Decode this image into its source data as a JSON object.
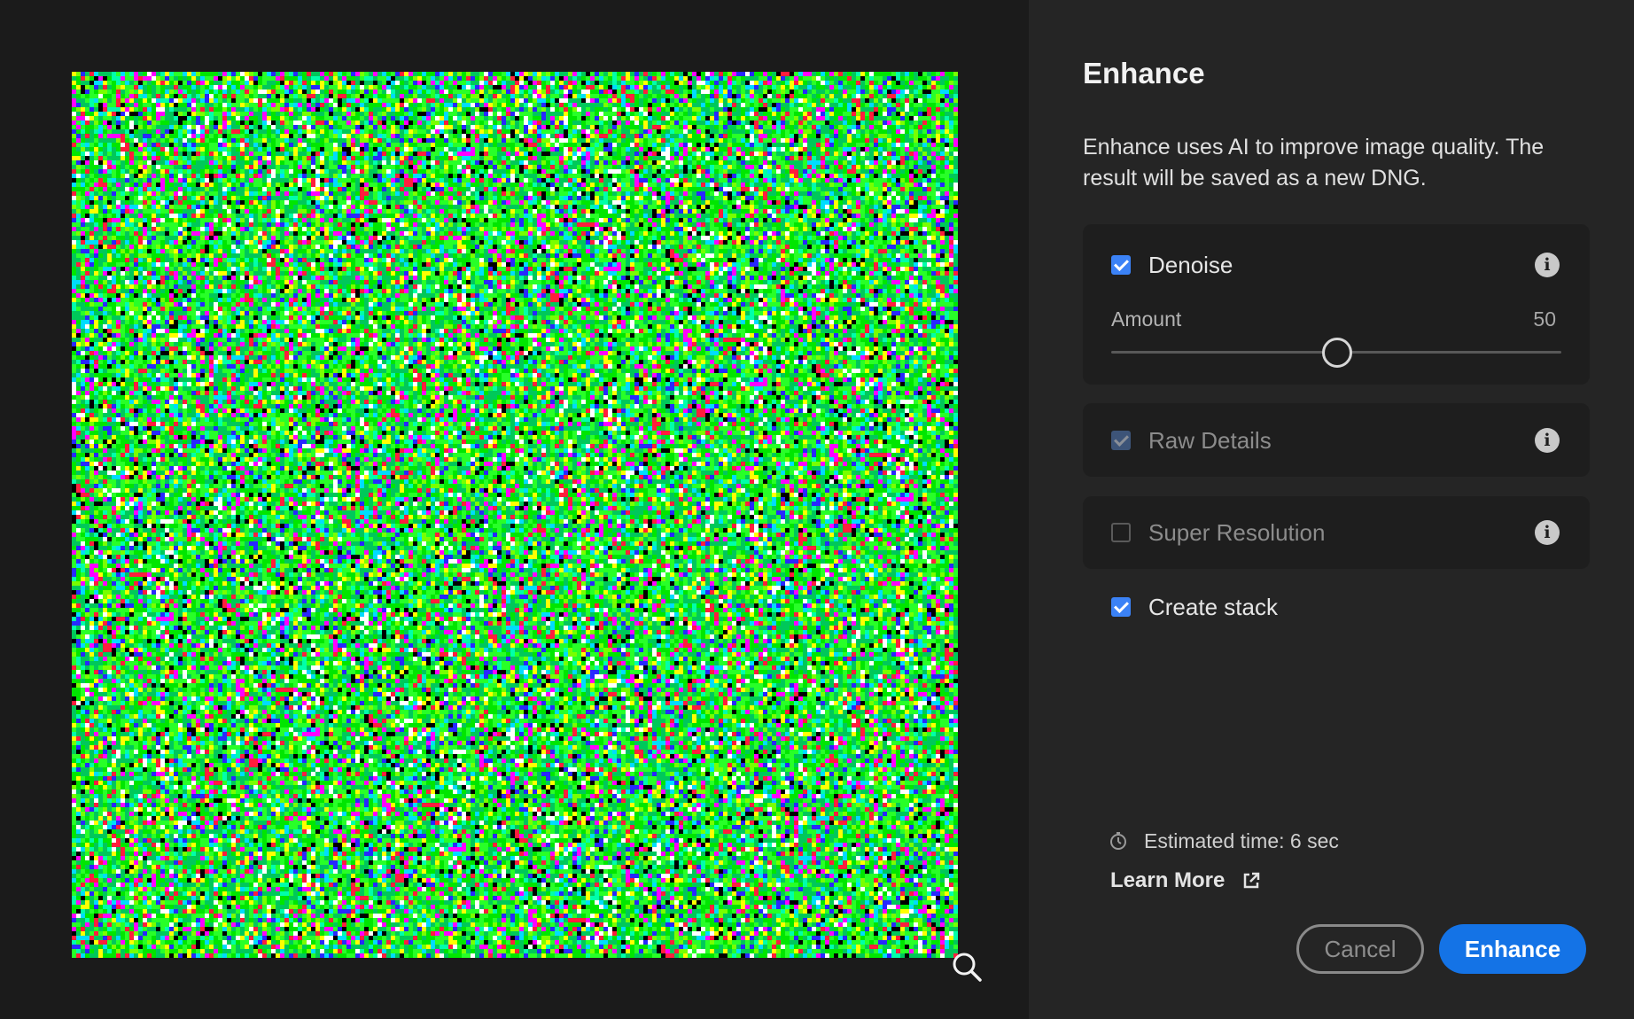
{
  "dialog": {
    "title": "Enhance",
    "description": "Enhance uses AI to improve image quality. The result will be saved as a new DNG."
  },
  "options": {
    "denoise": {
      "label": "Denoise",
      "checked": true,
      "amount_label": "Amount",
      "amount_value": "50",
      "slider_fraction": 0.5
    },
    "raw_details": {
      "label": "Raw Details",
      "checked": true,
      "disabled": true
    },
    "super_resolution": {
      "label": "Super Resolution",
      "checked": false,
      "disabled": true
    },
    "create_stack": {
      "label": "Create stack",
      "checked": true
    }
  },
  "footer": {
    "estimated_time": "Estimated time: 6 sec",
    "learn_more": "Learn More",
    "cancel_label": "Cancel",
    "enhance_label": "Enhance"
  },
  "icons": {
    "info": "info-icon",
    "clock": "clock-icon",
    "external_link": "external-link-icon",
    "zoom": "zoom-icon"
  },
  "colors": {
    "accent": "#1473e6",
    "checkbox": "#3b82f6"
  }
}
